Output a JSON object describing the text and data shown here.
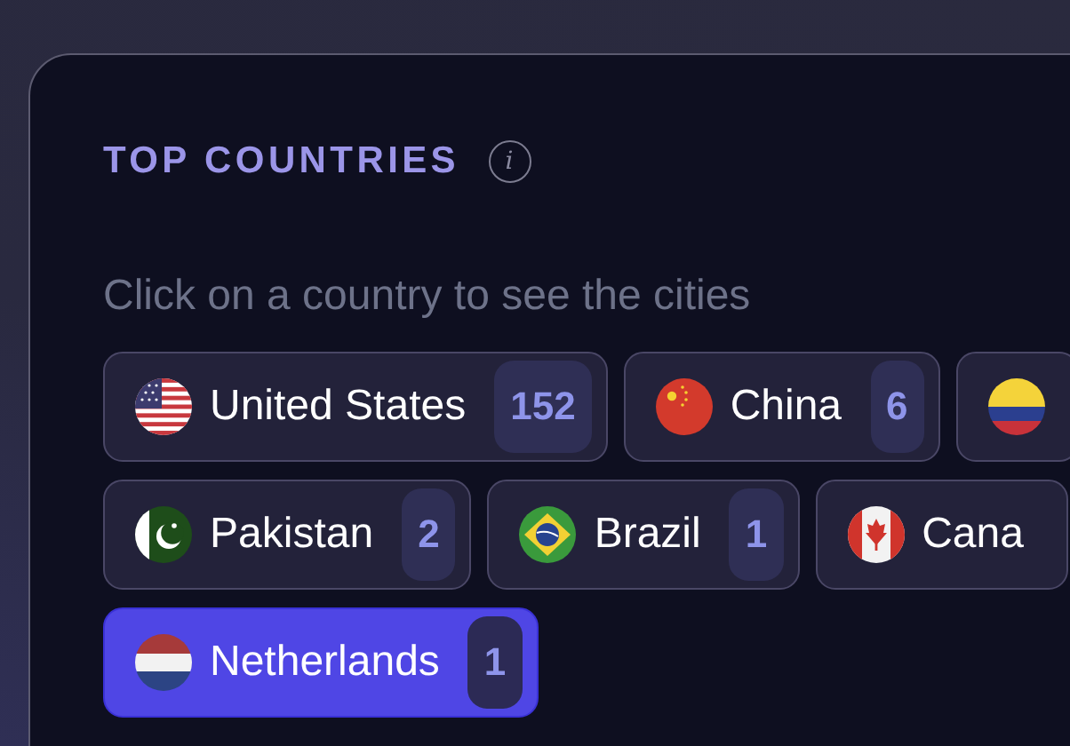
{
  "card": {
    "title": "TOP COUNTRIES",
    "info_icon": "i",
    "hint": "Click on a country to see the cities",
    "rows": [
      [
        {
          "kind": "us",
          "label": "United States",
          "count": "152",
          "selected": false
        },
        {
          "kind": "cn",
          "label": "China",
          "count": "6",
          "selected": false
        },
        {
          "kind": "co",
          "selected": false
        }
      ],
      [
        {
          "kind": "pk",
          "label": "Pakistan",
          "count": "2",
          "selected": false
        },
        {
          "kind": "br",
          "label": "Brazil",
          "count": "1",
          "selected": false
        },
        {
          "kind": "ca",
          "label": "Cana",
          "selected": false
        }
      ],
      [
        {
          "kind": "nl",
          "label": "Netherlands",
          "count": "1",
          "selected": true
        }
      ]
    ]
  }
}
